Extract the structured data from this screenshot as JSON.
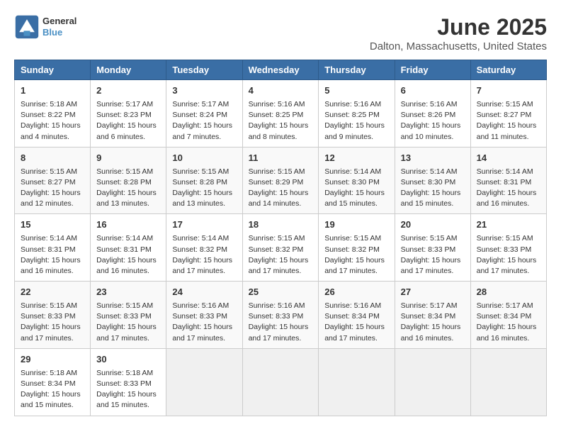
{
  "app": {
    "name": "GeneralBlue",
    "logo_line1": "General",
    "logo_line2": "Blue"
  },
  "calendar": {
    "month": "June 2025",
    "location": "Dalton, Massachusetts, United States",
    "headers": [
      "Sunday",
      "Monday",
      "Tuesday",
      "Wednesday",
      "Thursday",
      "Friday",
      "Saturday"
    ],
    "weeks": [
      [
        {
          "day": "1",
          "lines": [
            "Sunrise: 5:18 AM",
            "Sunset: 8:22 PM",
            "Daylight: 15 hours",
            "and 4 minutes."
          ]
        },
        {
          "day": "2",
          "lines": [
            "Sunrise: 5:17 AM",
            "Sunset: 8:23 PM",
            "Daylight: 15 hours",
            "and 6 minutes."
          ]
        },
        {
          "day": "3",
          "lines": [
            "Sunrise: 5:17 AM",
            "Sunset: 8:24 PM",
            "Daylight: 15 hours",
            "and 7 minutes."
          ]
        },
        {
          "day": "4",
          "lines": [
            "Sunrise: 5:16 AM",
            "Sunset: 8:25 PM",
            "Daylight: 15 hours",
            "and 8 minutes."
          ]
        },
        {
          "day": "5",
          "lines": [
            "Sunrise: 5:16 AM",
            "Sunset: 8:25 PM",
            "Daylight: 15 hours",
            "and 9 minutes."
          ]
        },
        {
          "day": "6",
          "lines": [
            "Sunrise: 5:16 AM",
            "Sunset: 8:26 PM",
            "Daylight: 15 hours",
            "and 10 minutes."
          ]
        },
        {
          "day": "7",
          "lines": [
            "Sunrise: 5:15 AM",
            "Sunset: 8:27 PM",
            "Daylight: 15 hours",
            "and 11 minutes."
          ]
        }
      ],
      [
        {
          "day": "8",
          "lines": [
            "Sunrise: 5:15 AM",
            "Sunset: 8:27 PM",
            "Daylight: 15 hours",
            "and 12 minutes."
          ]
        },
        {
          "day": "9",
          "lines": [
            "Sunrise: 5:15 AM",
            "Sunset: 8:28 PM",
            "Daylight: 15 hours",
            "and 13 minutes."
          ]
        },
        {
          "day": "10",
          "lines": [
            "Sunrise: 5:15 AM",
            "Sunset: 8:28 PM",
            "Daylight: 15 hours",
            "and 13 minutes."
          ]
        },
        {
          "day": "11",
          "lines": [
            "Sunrise: 5:15 AM",
            "Sunset: 8:29 PM",
            "Daylight: 15 hours",
            "and 14 minutes."
          ]
        },
        {
          "day": "12",
          "lines": [
            "Sunrise: 5:14 AM",
            "Sunset: 8:30 PM",
            "Daylight: 15 hours",
            "and 15 minutes."
          ]
        },
        {
          "day": "13",
          "lines": [
            "Sunrise: 5:14 AM",
            "Sunset: 8:30 PM",
            "Daylight: 15 hours",
            "and 15 minutes."
          ]
        },
        {
          "day": "14",
          "lines": [
            "Sunrise: 5:14 AM",
            "Sunset: 8:31 PM",
            "Daylight: 15 hours",
            "and 16 minutes."
          ]
        }
      ],
      [
        {
          "day": "15",
          "lines": [
            "Sunrise: 5:14 AM",
            "Sunset: 8:31 PM",
            "Daylight: 15 hours",
            "and 16 minutes."
          ]
        },
        {
          "day": "16",
          "lines": [
            "Sunrise: 5:14 AM",
            "Sunset: 8:31 PM",
            "Daylight: 15 hours",
            "and 16 minutes."
          ]
        },
        {
          "day": "17",
          "lines": [
            "Sunrise: 5:14 AM",
            "Sunset: 8:32 PM",
            "Daylight: 15 hours",
            "and 17 minutes."
          ]
        },
        {
          "day": "18",
          "lines": [
            "Sunrise: 5:15 AM",
            "Sunset: 8:32 PM",
            "Daylight: 15 hours",
            "and 17 minutes."
          ]
        },
        {
          "day": "19",
          "lines": [
            "Sunrise: 5:15 AM",
            "Sunset: 8:32 PM",
            "Daylight: 15 hours",
            "and 17 minutes."
          ]
        },
        {
          "day": "20",
          "lines": [
            "Sunrise: 5:15 AM",
            "Sunset: 8:33 PM",
            "Daylight: 15 hours",
            "and 17 minutes."
          ]
        },
        {
          "day": "21",
          "lines": [
            "Sunrise: 5:15 AM",
            "Sunset: 8:33 PM",
            "Daylight: 15 hours",
            "and 17 minutes."
          ]
        }
      ],
      [
        {
          "day": "22",
          "lines": [
            "Sunrise: 5:15 AM",
            "Sunset: 8:33 PM",
            "Daylight: 15 hours",
            "and 17 minutes."
          ]
        },
        {
          "day": "23",
          "lines": [
            "Sunrise: 5:15 AM",
            "Sunset: 8:33 PM",
            "Daylight: 15 hours",
            "and 17 minutes."
          ]
        },
        {
          "day": "24",
          "lines": [
            "Sunrise: 5:16 AM",
            "Sunset: 8:33 PM",
            "Daylight: 15 hours",
            "and 17 minutes."
          ]
        },
        {
          "day": "25",
          "lines": [
            "Sunrise: 5:16 AM",
            "Sunset: 8:33 PM",
            "Daylight: 15 hours",
            "and 17 minutes."
          ]
        },
        {
          "day": "26",
          "lines": [
            "Sunrise: 5:16 AM",
            "Sunset: 8:34 PM",
            "Daylight: 15 hours",
            "and 17 minutes."
          ]
        },
        {
          "day": "27",
          "lines": [
            "Sunrise: 5:17 AM",
            "Sunset: 8:34 PM",
            "Daylight: 15 hours",
            "and 16 minutes."
          ]
        },
        {
          "day": "28",
          "lines": [
            "Sunrise: 5:17 AM",
            "Sunset: 8:34 PM",
            "Daylight: 15 hours",
            "and 16 minutes."
          ]
        }
      ],
      [
        {
          "day": "29",
          "lines": [
            "Sunrise: 5:18 AM",
            "Sunset: 8:34 PM",
            "Daylight: 15 hours",
            "and 15 minutes."
          ]
        },
        {
          "day": "30",
          "lines": [
            "Sunrise: 5:18 AM",
            "Sunset: 8:33 PM",
            "Daylight: 15 hours",
            "and 15 minutes."
          ]
        },
        null,
        null,
        null,
        null,
        null
      ]
    ]
  }
}
